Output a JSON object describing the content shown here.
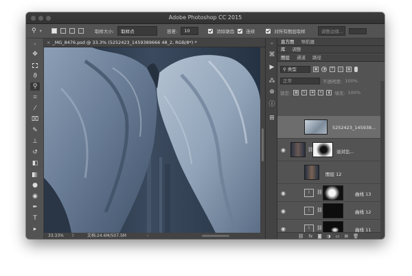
{
  "window": {
    "title": "Adobe Photoshop CC 2015"
  },
  "options_bar": {
    "sample_size_label": "取样大小:",
    "sample_size_value": "取样点",
    "tolerance_label": "容差:",
    "tolerance_value": "10",
    "anti_alias_label": "消除锯齿",
    "contiguous_label": "连续",
    "sample_all_layers_label": "对所有图层取样",
    "refine_edge_label": "调整边缘..."
  },
  "document": {
    "tab_title": "_MG_8476.psd @ 33.3% (5252423_1459389666 48_2, RGB/8*) *",
    "zoom": "33.33%",
    "doc_size": "文档:24.6M/507.5M"
  },
  "panels": {
    "top_tabs": [
      "直方图",
      "导航器"
    ],
    "mid_tabs": [
      "库",
      "调整"
    ],
    "layer_tabs": [
      "图层",
      "通道",
      "路径"
    ],
    "filter_kind": "类型",
    "blend_mode": "正常",
    "opacity_label": "不透明度:",
    "opacity_value": "100%",
    "lock_label": "锁定:",
    "fill_label": "填充:",
    "fill_value": "100%"
  },
  "layers": [
    {
      "name": "5252423_145938...",
      "selected": true
    },
    {
      "name": "淡对比..."
    },
    {
      "name": "图层 12"
    },
    {
      "name": "曲线 13"
    },
    {
      "name": "曲线 12"
    },
    {
      "name": "曲线 11"
    }
  ],
  "colors": {
    "chrome": "#535353",
    "dark_chrome": "#434343",
    "selected_layer": "#6d6d6d",
    "fabric": "#7c8ea6"
  }
}
